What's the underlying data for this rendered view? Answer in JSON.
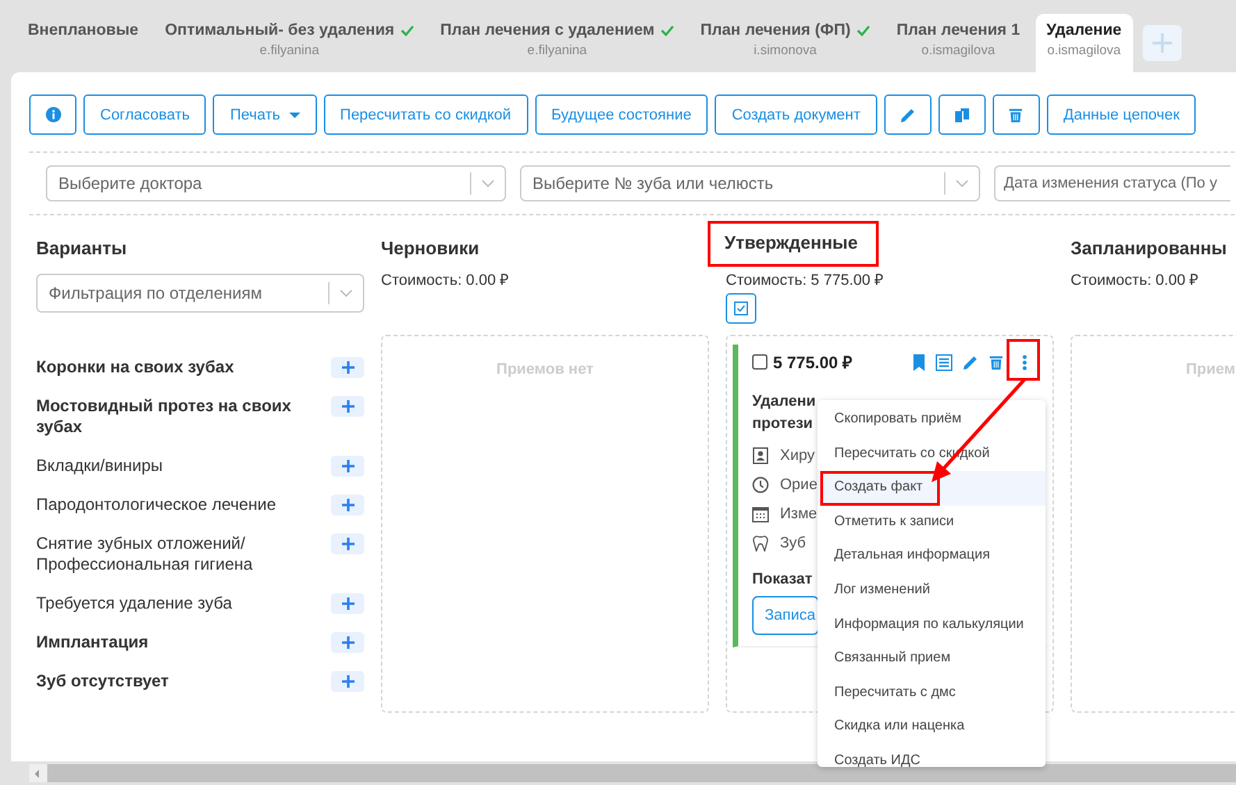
{
  "tabs": [
    {
      "label": "Внеплановые",
      "selected": false,
      "approved": false
    },
    {
      "label": "Оптимальный- без удаления",
      "user": "e.filyanina",
      "selected": false,
      "approved": true
    },
    {
      "label": "План лечения с удалением",
      "user": "e.filyanina",
      "selected": false,
      "approved": true
    },
    {
      "label": "План лечения (ФП)",
      "user": "i.simonova",
      "selected": false,
      "approved": true
    },
    {
      "label": "План лечения 1",
      "user": "o.ismagilova",
      "selected": false,
      "approved": false
    },
    {
      "label": "Удаление",
      "user": "o.ismagilova",
      "selected": true,
      "approved": false
    }
  ],
  "toolbar": [
    {
      "kind": "info"
    },
    {
      "kind": "text",
      "label": "Согласовать"
    },
    {
      "kind": "dropdown",
      "label": "Печать"
    },
    {
      "kind": "text",
      "label": "Пересчитать со скидкой"
    },
    {
      "kind": "text",
      "label": "Будущее состояние"
    },
    {
      "kind": "text",
      "label": "Создать документ"
    },
    {
      "kind": "edit"
    },
    {
      "kind": "copy"
    },
    {
      "kind": "delete"
    },
    {
      "kind": "text",
      "label": "Данные цепочек"
    }
  ],
  "filters": [
    {
      "placeholder": "Выберите доктора"
    },
    {
      "placeholder": "Выберите № зуба или челюсть"
    },
    {
      "placeholder": "Дата изменения статуса (По у"
    }
  ],
  "variants": {
    "title": "Варианты",
    "filter_placeholder": "Фильтрация по отделениям",
    "items": [
      "Коронки на своих зубах",
      "Мостовидный протез на своих зубах",
      "Вкладки/виниры",
      "Пародонтологическое лечение",
      "Снятие зубных отложений/ Профессиональная гигиена",
      "Требуется удаление зуба",
      "Имплантация",
      "Зуб отсутствует"
    ]
  },
  "columns": [
    {
      "title": "Черновики",
      "cost": "Стоимость: 0.00 ₽",
      "highlighted": false,
      "empty_text": "Приемов нет"
    },
    {
      "title": "Утвержденные",
      "cost": "Стоимость: 5 775.00 ₽",
      "highlighted": true,
      "select_all": true,
      "card": {
        "checked": false,
        "price": "5 775.00 ₽",
        "title": "Удалени",
        "title_2": "протези",
        "rows": [
          {
            "kind": "doctor",
            "text": "Хиру"
          },
          {
            "kind": "time",
            "text": "Орие"
          },
          {
            "kind": "calendar",
            "text": "Изме"
          },
          {
            "kind": "tooth",
            "text": "Зуб"
          }
        ],
        "show_label": "Показат",
        "button": "Записа"
      }
    },
    {
      "title": "Запланированны",
      "cost": "Стоимость: 0.00 ₽",
      "highlighted": false,
      "empty_text": "Прием"
    }
  ],
  "menu": [
    {
      "label": "Скопировать приём",
      "selected": false
    },
    {
      "label": "Пересчитать со скидкой",
      "selected": false
    },
    {
      "label": "Создать факт",
      "selected": true
    },
    {
      "label": "Отметить к записи",
      "selected": false
    },
    {
      "label": "Детальная информация",
      "selected": false
    },
    {
      "label": "Лог изменений",
      "selected": false
    },
    {
      "label": "Информация по калькуляции",
      "selected": false
    },
    {
      "label": "Связанный прием",
      "selected": false
    },
    {
      "label": "Пересчитать с дмс",
      "selected": false
    },
    {
      "label": "Скидка или наценка",
      "selected": false
    },
    {
      "label": "Создать ИДС",
      "selected": false
    }
  ]
}
